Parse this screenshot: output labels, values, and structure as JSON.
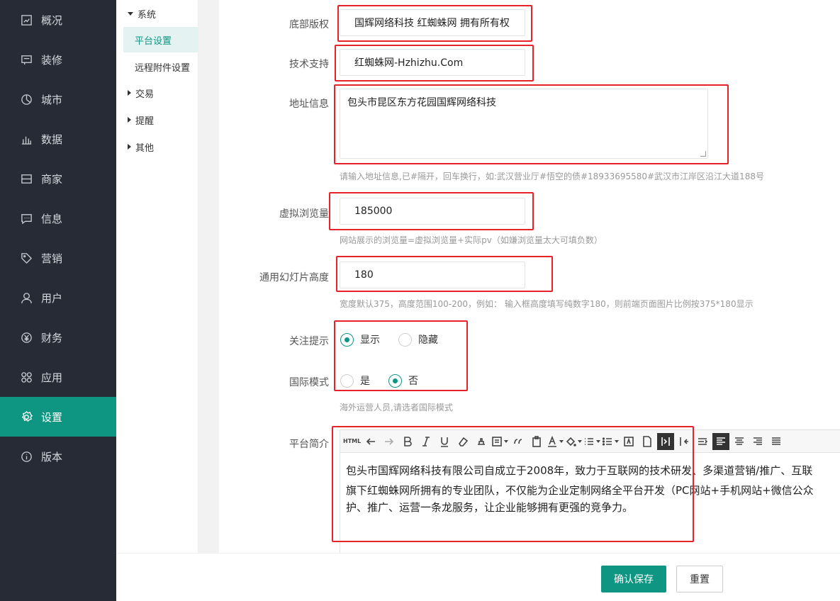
{
  "sidebar": {
    "items": [
      {
        "label": "概况",
        "icon": "overview-icon"
      },
      {
        "label": "装修",
        "icon": "decorate-icon"
      },
      {
        "label": "城市",
        "icon": "city-icon"
      },
      {
        "label": "数据",
        "icon": "chart-icon"
      },
      {
        "label": "商家",
        "icon": "store-icon"
      },
      {
        "label": "信息",
        "icon": "message-icon"
      },
      {
        "label": "营销",
        "icon": "tag-icon"
      },
      {
        "label": "用户",
        "icon": "user-icon"
      },
      {
        "label": "财务",
        "icon": "yen-icon"
      },
      {
        "label": "应用",
        "icon": "apps-icon"
      },
      {
        "label": "设置",
        "icon": "gear-icon"
      },
      {
        "label": "版本",
        "icon": "info-icon"
      }
    ],
    "active_index": 10
  },
  "subnav": {
    "group_system": "系统",
    "item_platform": "平台设置",
    "item_remote": "远程附件设置",
    "group_trade": "交易",
    "group_remind": "提醒",
    "group_other": "其他"
  },
  "form": {
    "copyright_label": "底部版权",
    "copyright_value": "国辉网络科技 红蜘蛛网 拥有所有权",
    "support_label": "技术支持",
    "support_value": "红蜘蛛网-Hzhizhu.Com",
    "address_label": "地址信息",
    "address_value": "包头市昆区东方花园国辉网络科技",
    "address_hint": "请输入地址信息,已#隔开，回车换行，如:武汉营业厅#悟空的债#18933695580#武汉市江岸区沿江大道188号",
    "views_label": "虚拟浏览量",
    "views_value": "185000",
    "views_hint": "网站展示的浏览量=虚拟浏览量+实际pv（如嫌浏览量太大可填负数）",
    "slide_label": "通用幻灯片高度",
    "slide_value": "180",
    "slide_hint": "宽度默认375，高度范围100-200，例如： 输入框高度填写纯数字180，则前端页面图片比例按375*180显示",
    "follow_label": "关注提示",
    "follow_show": "显示",
    "follow_hide": "隐藏",
    "intl_label": "国际模式",
    "intl_yes": "是",
    "intl_no": "否",
    "intl_hint": "海外运营人员,请选者国际模式",
    "intro_label": "平台简介",
    "intro_line1": "包头市国辉网络科技有限公司自成立于2008年，致力于互联网的技术研发、多渠道营销/推广、互联",
    "intro_line2": "旗下红蜘蛛网所拥有的专业团队，不仅能为企业定制网络全平台开发（PC网站+手机网站+微信公众",
    "intro_line3": "护、推广、运营一条龙服务，让企业能够拥有更强的竞争力。"
  },
  "toolbar": {
    "html_label": "HTML"
  },
  "footer": {
    "save_label": "确认保存",
    "reset_label": "重置"
  },
  "colors": {
    "accent": "#0e9683",
    "sidebar_bg": "#262b35",
    "highlight": "#e8222b"
  }
}
